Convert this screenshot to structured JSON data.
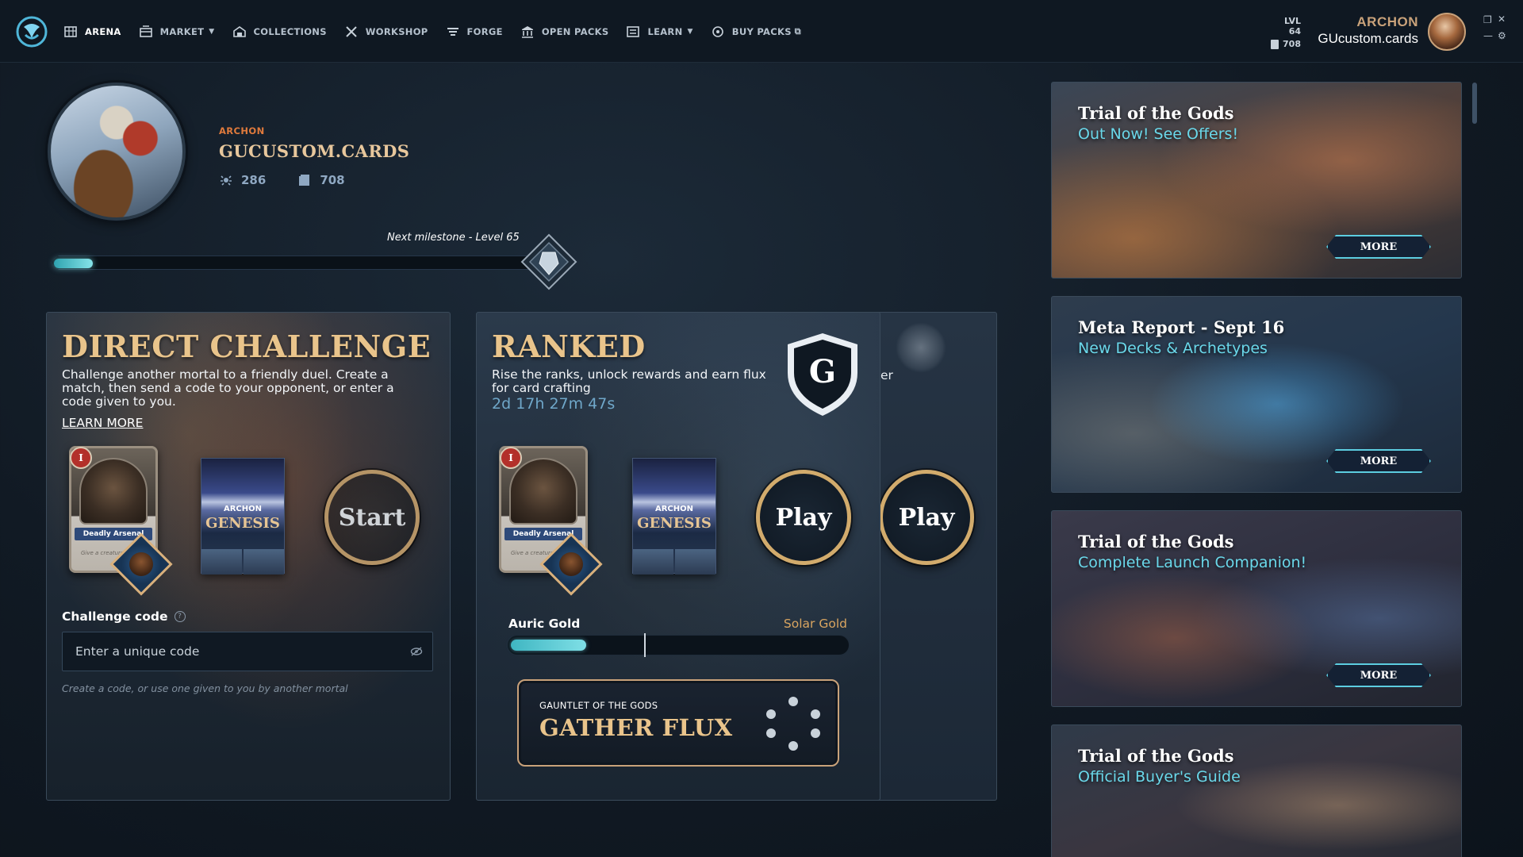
{
  "nav": {
    "items": [
      {
        "label": "ARENA",
        "icon": "arena-icon",
        "active": true
      },
      {
        "label": "MARKET",
        "icon": "market-icon",
        "dropdown": true
      },
      {
        "label": "COLLECTIONS",
        "icon": "collections-icon"
      },
      {
        "label": "WORKSHOP",
        "icon": "workshop-icon"
      },
      {
        "label": "FORGE",
        "icon": "forge-icon"
      },
      {
        "label": "OPEN PACKS",
        "icon": "open-packs-icon"
      },
      {
        "label": "LEARN",
        "icon": "learn-icon",
        "dropdown": true
      },
      {
        "label": "BUY PACKS",
        "icon": "buy-packs-icon",
        "external": true
      }
    ],
    "level_label": "LVL 64",
    "card_count": "708",
    "user_rank": "ARCHON",
    "username": "GUcustom.cards"
  },
  "profile": {
    "rank": "ARCHON",
    "name": "GUCUSTOM.CARDS",
    "stat_wins": "286",
    "stat_cards": "708",
    "milestone_label": "Next milestone - Level 65",
    "milestone_progress": 0.08
  },
  "direct_challenge": {
    "title": "DIRECT CHALLENGE",
    "description": "Challenge another mortal to a friendly duel. Create a match, then send a code to your opponent, or enter a code given to you.",
    "learn_more": "LEARN MORE",
    "card_name": "Deadly Arsenal",
    "card_text": "Give a creature +",
    "card_badge": "I",
    "pack_label": "ARCHON",
    "pack_title": "GENESIS",
    "start_label": "Start",
    "code_label": "Challenge code",
    "code_placeholder": "Enter a unique code",
    "code_hint": "Create a code, or use one given to you by another mortal"
  },
  "ranked": {
    "title": "RANKED",
    "description": "Rise the ranks, unlock rewards and earn flux for card crafting",
    "timer": "2d 17h 27m 47s",
    "shield_letter": "G",
    "card_name": "Deadly Arsenal",
    "card_text": "Give a creature +",
    "card_badge": "I",
    "pack_label": "ARCHON",
    "pack_title": "GENESIS",
    "play_label": "Play",
    "ladder_current": "Auric Gold",
    "ladder_next": "Solar Gold",
    "ladder_progress": 0.22,
    "gauntlet_sub": "GAUNTLET OF THE GODS",
    "gauntlet_title": "GATHER FLUX"
  },
  "third_panel": {
    "desc_fragment": "er",
    "play_label": "Play"
  },
  "news": [
    {
      "title": "Trial of the Gods",
      "subtitle": "Out Now! See Offers!",
      "more": "MORE"
    },
    {
      "title": "Meta Report - Sept 16",
      "subtitle": "New Decks & Archetypes",
      "more": "MORE"
    },
    {
      "title": "Trial of the Gods",
      "subtitle": "Complete Launch Companion!",
      "more": "MORE"
    },
    {
      "title": "Trial of the Gods",
      "subtitle": "Official Buyer's Guide"
    }
  ],
  "colors": {
    "accent_gold": "#e9c48b",
    "accent_cyan": "#6ad8ea",
    "rank_orange": "#e07a3c",
    "background": "#111a24"
  }
}
